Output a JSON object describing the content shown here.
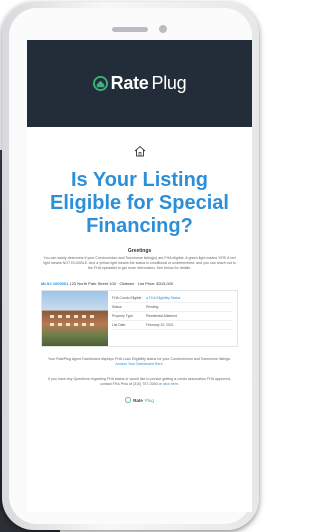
{
  "brand": {
    "name_first": "Rate",
    "name_second": "Plug",
    "colors": {
      "header": "#232d3a",
      "accent": "#2d8fd8",
      "green": "#3bb27a"
    }
  },
  "email": {
    "headline_line1": "Is Your Listing",
    "headline_line2": "Eligible for Special",
    "headline_line3": "Financing?",
    "body_title": "Greetings",
    "intro": "You can easily determine if your Condominium and Townhome listing(s) are FHA eligible. A green light means YES! A red light means NOT ELIGIBLE. And a yellow light means the status is conditional or undetermined, and you can reach out to the FHA specialist to get more information. See below for details.",
    "listing": {
      "label": "MLS# 1000001",
      "address": "123 North Park Street 100 · Oldtown · List Price: $315,000",
      "rows": [
        {
          "key": "FHA Condo Eligible",
          "value": "● FHA Eligibility Status"
        },
        {
          "key": "Status",
          "value": "Pending"
        },
        {
          "key": "Property Type",
          "value": "Residential Attached"
        },
        {
          "key": "List Date",
          "value": "February 10, 2021"
        }
      ]
    },
    "dashboard_text": "Your RatePlug Agent Dashboard displays FHA Loan Eligibility status for your Condominium and Townhome listings.",
    "dashboard_link": "Access Your Dashboard Here.",
    "contact_text": "If you have any Questions regarding FHA status or would like to pursue getting a condo association FHA approved, contact FHA Pros at (310) 757-0260 or",
    "contact_link": "click here.",
    "footer_brand_first": "Rate",
    "footer_brand_second": "Plug"
  },
  "icons": {
    "logo": "rateplug-logo-icon",
    "home": "home-icon"
  }
}
